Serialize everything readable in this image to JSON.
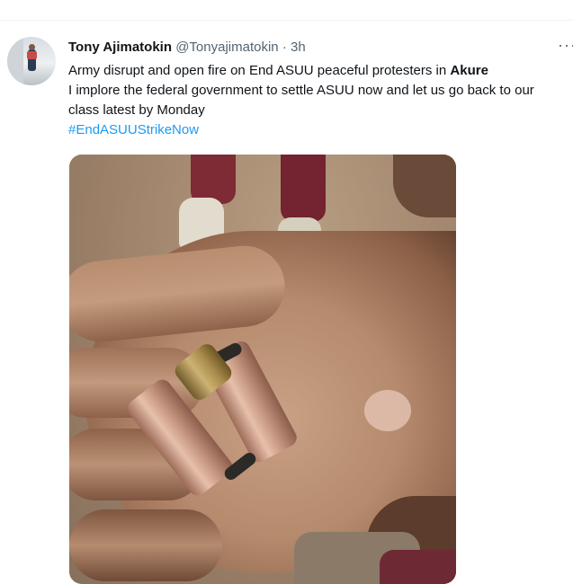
{
  "tweet": {
    "author_name": "Tony Ajimatokin",
    "author_handle": "@Tonyajimatokin",
    "separator": "·",
    "time": "3h",
    "more_label": "···",
    "text_line1_prefix": "Army disrupt and open fire on End ASUU peaceful protesters in ",
    "text_line1_bold": "Akure",
    "text_line2": "I implore the federal government to settle ASUU now and let us go back to our class latest by Monday",
    "hashtag": "#EndASUUStrikeNow"
  },
  "colors": {
    "hashtag": "#1d9bf0",
    "secondary_text": "#536471",
    "primary_text": "#0f1419"
  },
  "icons": {
    "more": "more-horizontal-icon"
  }
}
